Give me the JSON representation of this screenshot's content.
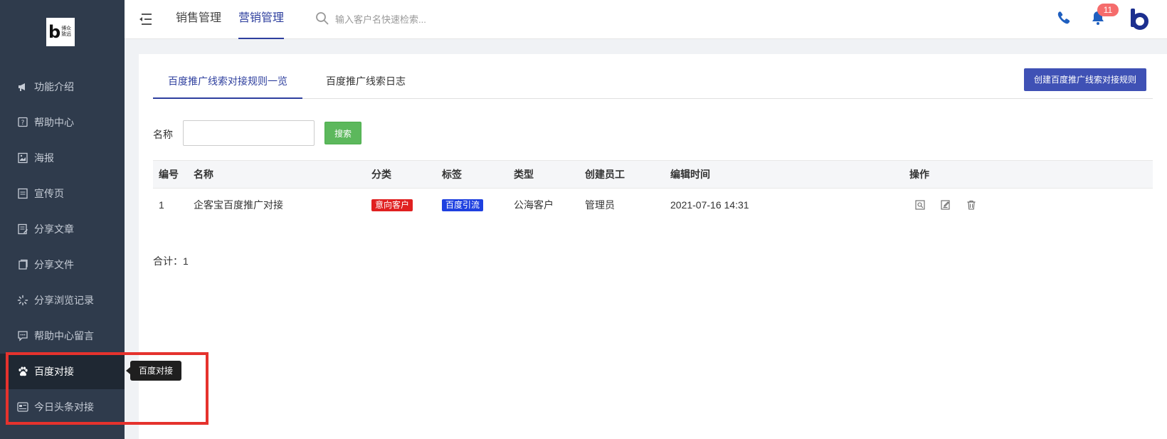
{
  "logo": {
    "letter": "b",
    "line1": "博众",
    "line2": "致远"
  },
  "sidebar": {
    "items": [
      {
        "label": "功能介绍",
        "icon": "megaphone-icon"
      },
      {
        "label": "帮助中心",
        "icon": "help-icon"
      },
      {
        "label": "海报",
        "icon": "poster-icon"
      },
      {
        "label": "宣传页",
        "icon": "page-icon"
      },
      {
        "label": "分享文章",
        "icon": "article-icon"
      },
      {
        "label": "分享文件",
        "icon": "file-icon"
      },
      {
        "label": "分享浏览记录",
        "icon": "loading-icon"
      },
      {
        "label": "帮助中心留言",
        "icon": "chat-icon"
      },
      {
        "label": "百度对接",
        "icon": "baidu-paw-icon",
        "active": true
      },
      {
        "label": "今日头条对接",
        "icon": "toutiao-icon"
      }
    ]
  },
  "tooltip": {
    "text": "百度对接"
  },
  "header": {
    "tabs": [
      "销售管理",
      "营销管理"
    ],
    "active_tab": "营销管理",
    "search_placeholder": "输入客户名快速检索...",
    "notification_count": "11"
  },
  "main": {
    "tabs": [
      "百度推广线索对接规则一览",
      "百度推广线索日志"
    ],
    "active_tab": "百度推广线索对接规则一览",
    "create_button": "创建百度推广线索对接规则",
    "filter": {
      "name_label": "名称",
      "name_value": "",
      "search_button": "搜索"
    },
    "table": {
      "columns": [
        "编号",
        "名称",
        "分类",
        "标签",
        "类型",
        "创建员工",
        "编辑时间",
        "操作"
      ],
      "rows": [
        {
          "id": "1",
          "name": "企客宝百度推广对接",
          "category": "意向客户",
          "tag": "百度引流",
          "type": "公海客户",
          "creator": "管理员",
          "edited": "2021-07-16 14:31"
        }
      ]
    },
    "total_label": "合计：",
    "total_value": "1"
  },
  "colors": {
    "sidebar_bg": "#2f3b4c",
    "accent": "#2e3f9e",
    "primary_button": "#3f51b5",
    "search_button": "#5cb85c",
    "tag_red": "#e02020",
    "tag_blue": "#1e40e0",
    "highlight": "#e5322d"
  }
}
